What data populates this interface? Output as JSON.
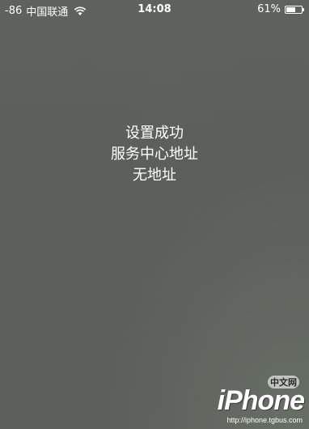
{
  "status_bar": {
    "signal": "-86",
    "carrier": "中国联通",
    "wifi_icon": "wifi-icon",
    "time": "14:08",
    "battery_percent": "61%",
    "battery_level": 0.61,
    "battery_icon": "battery-icon"
  },
  "message": {
    "line1": "设置成功",
    "line2": "服务中心地址",
    "line3": "无地址"
  },
  "watermark": {
    "logo": "iPhone",
    "badge": "中文网",
    "url": "http://iphone.tgbus.com"
  }
}
